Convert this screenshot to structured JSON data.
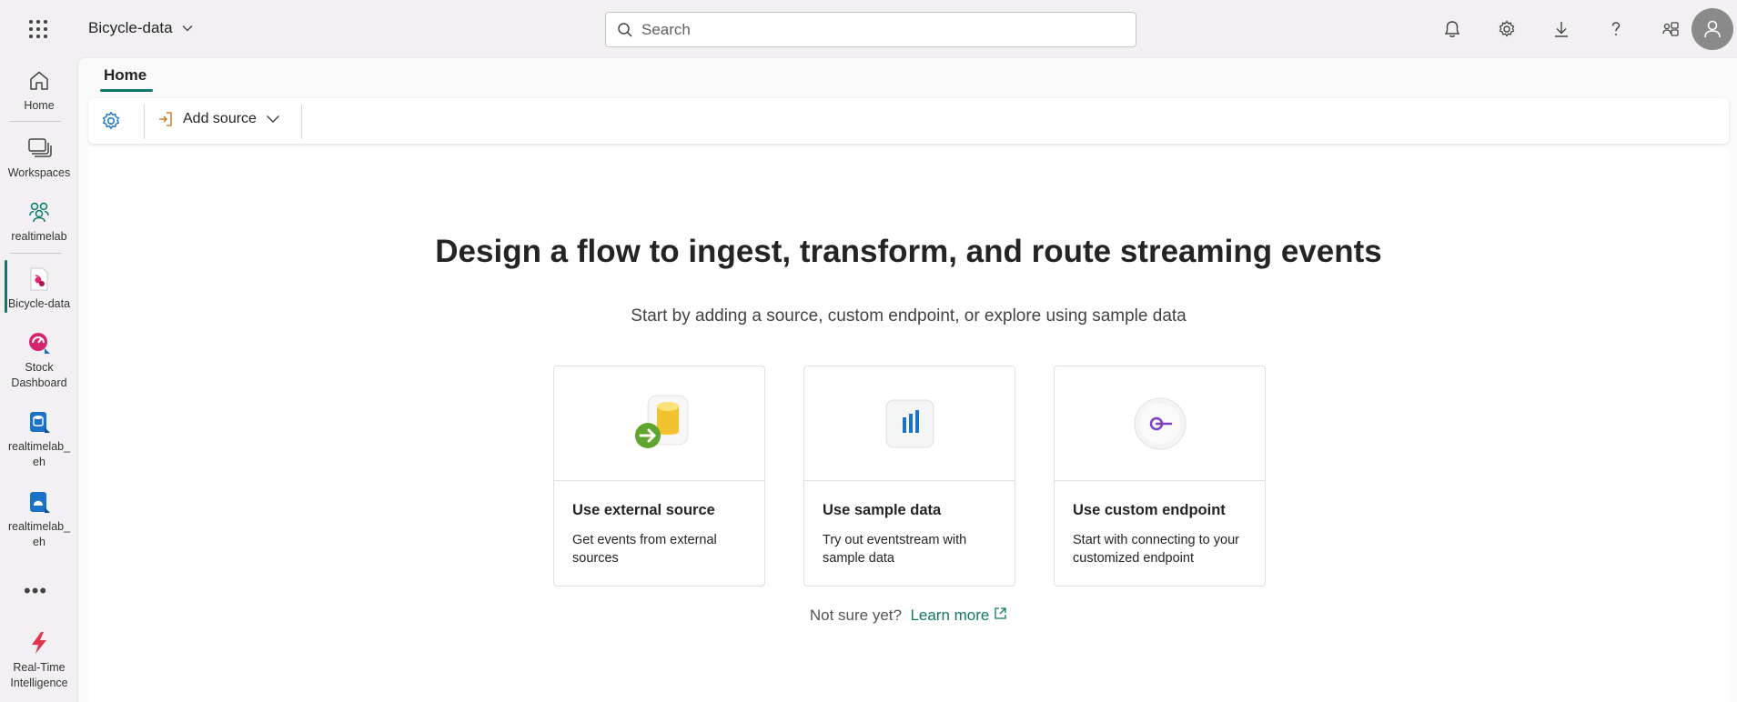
{
  "header": {
    "app_title": "Bicycle-data",
    "search_placeholder": "Search",
    "icons": [
      "bell-icon",
      "gear-icon",
      "download-icon",
      "help-icon",
      "share-icon",
      "avatar"
    ]
  },
  "rail": {
    "items": [
      {
        "label": "Home",
        "icon": "home-icon"
      },
      {
        "label": "Workspaces",
        "icon": "workspaces-icon"
      },
      {
        "label": "realtimelab",
        "icon": "group-icon"
      },
      {
        "label": "Bicycle-data",
        "icon": "eventstream-icon"
      },
      {
        "label": "Stock Dashboard",
        "icon": "dashboard-icon"
      },
      {
        "label": "realtimelab_ eh",
        "icon": "eventhouse-icon"
      },
      {
        "label": "realtimelab_ eh",
        "icon": "kql-icon"
      },
      {
        "label": "Real-Time Intelligence",
        "icon": "realtime-icon"
      }
    ],
    "more": "•••"
  },
  "tabs": {
    "home": "Home"
  },
  "toolbar": {
    "add_source": "Add source"
  },
  "main": {
    "headline": "Design a flow to ingest, transform, and route streaming events",
    "subline": "Start by adding a source, custom endpoint, or explore using sample data",
    "cards": [
      {
        "title": "Use external source",
        "desc": "Get events from external sources"
      },
      {
        "title": "Use sample data",
        "desc": "Try out eventstream with sample data"
      },
      {
        "title": "Use custom endpoint",
        "desc": "Start with connecting to your customized endpoint"
      }
    ],
    "not_sure": "Not sure yet?",
    "learn_more": "Learn more"
  },
  "colors": {
    "accent": "#117865",
    "background": "#f3f0f4"
  }
}
